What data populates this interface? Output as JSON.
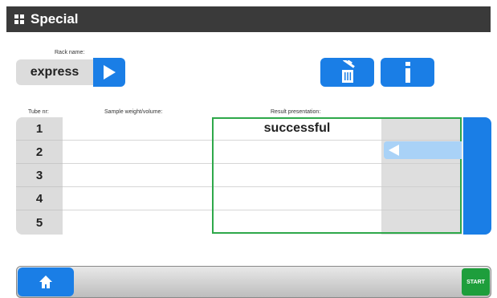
{
  "window": {
    "title": "Special"
  },
  "rack": {
    "label": "Rack name:",
    "value": "express"
  },
  "columns": {
    "tube": "Tube nr:",
    "weight": "Sample weight/volume:",
    "result": "Result presentation:"
  },
  "rows": [
    {
      "num": "1",
      "weight": "",
      "result": "successful"
    },
    {
      "num": "2",
      "weight": "",
      "result": ""
    },
    {
      "num": "3",
      "weight": "",
      "result": ""
    },
    {
      "num": "4",
      "weight": "",
      "result": ""
    },
    {
      "num": "5",
      "weight": "",
      "result": ""
    }
  ],
  "footer": {
    "start_label": "START"
  },
  "colors": {
    "titlebar": "#3a3a3a",
    "accent_blue": "#1a7ee6",
    "light_blue": "#a9d2f7",
    "green_border": "#2ea84a",
    "start_green": "#1e9e3c"
  },
  "icons": [
    "grid-icon",
    "play-icon",
    "trash-icon",
    "info-icon",
    "back-arrow-icon",
    "home-icon"
  ]
}
